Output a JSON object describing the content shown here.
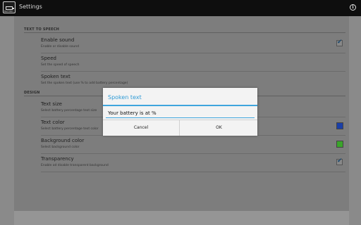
{
  "app": {
    "title": "Settings",
    "icon_label": "BATTERY"
  },
  "sections": {
    "tts": {
      "header": "TEXT TO SPEECH"
    },
    "design": {
      "header": "DESIGN"
    }
  },
  "rows": {
    "enable_sound": {
      "title": "Enable sound",
      "summary": "Enable or disable sound",
      "checked": true
    },
    "speed": {
      "title": "Speed",
      "summary": "Set the speed of speech"
    },
    "spoken_text": {
      "title": "Spoken text",
      "summary": "Set the spoken text (use % to add battery percentage)"
    },
    "text_size": {
      "title": "Text size",
      "summary": "Select battery percentage text size"
    },
    "text_color": {
      "title": "Text color",
      "summary": "Select battery percentage text color",
      "color": "#1a3fa8"
    },
    "background_color": {
      "title": "Background color",
      "summary": "Select background color",
      "color": "#3aa52a"
    },
    "transparency": {
      "title": "Transparency",
      "summary": "Enable od disable transparent background",
      "checked": true
    }
  },
  "dialog": {
    "title": "Spoken text",
    "input_value": "Your battery is at %",
    "cancel_label": "Cancel",
    "ok_label": "OK"
  },
  "colors": {
    "accent": "#33b5e5"
  }
}
